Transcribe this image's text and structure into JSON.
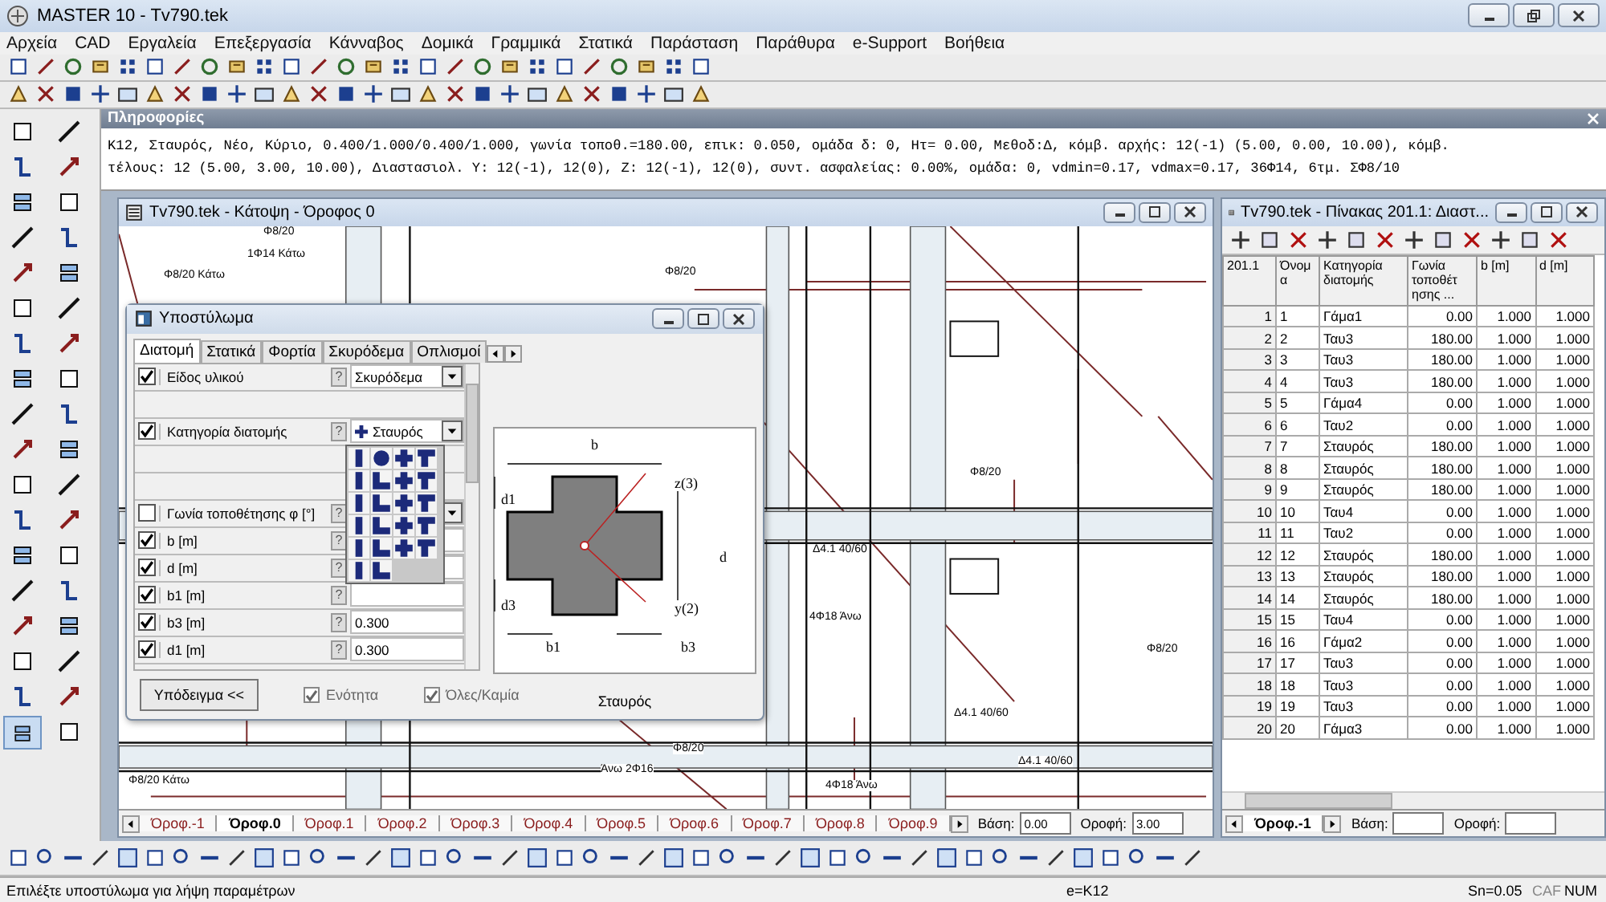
{
  "window": {
    "title": "MASTER 10 - Tv790.tek"
  },
  "menu": [
    "Αρχεία",
    "CAD",
    "Εργαλεία",
    "Επεξεργασία",
    "Κάνναβος",
    "Δομικά",
    "Γραμμικά",
    "Στατικά",
    "Παράσταση",
    "Παράθυρα",
    "e-Support",
    "Βοήθεια"
  ],
  "info_panel": {
    "title": "Πληροφορίες",
    "lines": [
      "K12, Σταυρός, Νέο, Κύριο, 0.400/1.000/0.400/1.000, γωνία τοποθ.=180.00,  επικ: 0.050, ομάδα δ: 0, Ητ= 0.00, Μεθοδ:Δ,  κόμβ. αρχής: 12(-1) (5.00, 0.00, 10.00),  κόμβ.",
      "τέλους: 12 (5.00, 3.00, 10.00), Διαστασιολ. Υ: 12(-1), 12(0), Z: 12(-1), 12(0), συντ. ασφαλείας: 0.00%,  ομάδα: 0, vdmin=0.17, vdmax=0.17,  36Φ14,  6τμ. ΣΦ8/10"
    ]
  },
  "plan_window": {
    "title": "Tv790.tek - Κάτοψη - Όροφος 0",
    "labels": [
      "1Φ14 Κάτω",
      "Φ8/20 Κάτω",
      "Φ8/20",
      "Φ8/20",
      "Δ4.1 40/60",
      "4Φ18 Άνω",
      "Φ8/20",
      "Δ4.1 40/60",
      "Φ8/20",
      "4Φ18 Άνω",
      "Δ4.1 40/60",
      "Φ8/20 Κάτω",
      "Άνω 2Φ16",
      "Φ8/20"
    ],
    "tabs": [
      {
        "label": "Όροφ.-1",
        "selected": false
      },
      {
        "label": "Όροφ.0",
        "selected": true
      },
      {
        "label": "Όροφ.1",
        "selected": false
      },
      {
        "label": "Όροφ.2",
        "selected": false
      },
      {
        "label": "Όροφ.3",
        "selected": false
      },
      {
        "label": "Όροφ.4",
        "selected": false
      },
      {
        "label": "Όροφ.5",
        "selected": false
      },
      {
        "label": "Όροφ.6",
        "selected": false
      },
      {
        "label": "Όροφ.7",
        "selected": false
      },
      {
        "label": "Όροφ.8",
        "selected": false
      },
      {
        "label": "Όροφ.9",
        "selected": false
      }
    ],
    "base_label": "Βάση:",
    "base_value": "0.00",
    "top_label": "Οροφή:",
    "top_value": "3.00"
  },
  "dialog": {
    "title": "Υποστύλωμα",
    "tabs": [
      {
        "label": "Διατομή",
        "selected": true
      },
      {
        "label": "Στατικά",
        "selected": false
      },
      {
        "label": "Φορτία",
        "selected": false
      },
      {
        "label": "Σκυρόδεμα",
        "selected": false
      },
      {
        "label": "Οπλισμοί",
        "selected": false
      }
    ],
    "rows": [
      {
        "kind": "dropdown",
        "label": "Είδος υλικού",
        "checked": true,
        "value": "Σκυρόδεμα"
      },
      {
        "kind": "spacer"
      },
      {
        "kind": "dropdown",
        "label": "Κατηγορία διατομής",
        "checked": true,
        "value": "Σταυρός"
      },
      {
        "kind": "spacer"
      },
      {
        "kind": "spacer"
      },
      {
        "kind": "dropdown",
        "label": "Γωνία τοποθέτησης φ [°]",
        "checked": false
      },
      {
        "kind": "text",
        "label": "b [m]",
        "checked": true
      },
      {
        "kind": "text",
        "label": "d [m]",
        "checked": true
      },
      {
        "kind": "text",
        "label": "b1 [m]",
        "checked": true
      },
      {
        "kind": "text",
        "label": "b3 [m]",
        "checked": true,
        "value": "0.300"
      },
      {
        "kind": "text",
        "label": "d1 [m]",
        "checked": true,
        "value": "0.300"
      }
    ],
    "help": "?",
    "section": {
      "labels": [
        "b",
        "d1",
        "z(3)",
        "d",
        "d3",
        "y(2)",
        "b1",
        "b3"
      ],
      "caption": "Σταυρός"
    },
    "sample_button": "Υπόδειγμα <<",
    "options": [
      {
        "label": "Ενότητα",
        "checked": true,
        "disabled": true
      },
      {
        "label": "Όλες/Καμία",
        "checked": true,
        "disabled": true
      }
    ]
  },
  "table_window": {
    "title": "Tv790.tek - Πίνακας 201.1: Διαστ...",
    "columns": [
      "201.1",
      "Όνομ α",
      "Κατηγορία διατομής",
      "Γωνία τοποθέτ ησης ...",
      "b [m]",
      "d [m]"
    ],
    "rows": [
      [
        "1",
        "1",
        "Γάμα1",
        "0.00",
        "1.000",
        "1.000"
      ],
      [
        "2",
        "2",
        "Ταυ3",
        "180.00",
        "1.000",
        "1.000"
      ],
      [
        "3",
        "3",
        "Ταυ3",
        "180.00",
        "1.000",
        "1.000"
      ],
      [
        "4",
        "4",
        "Ταυ3",
        "180.00",
        "1.000",
        "1.000"
      ],
      [
        "5",
        "5",
        "Γάμα4",
        "0.00",
        "1.000",
        "1.000"
      ],
      [
        "6",
        "6",
        "Ταυ2",
        "0.00",
        "1.000",
        "1.000"
      ],
      [
        "7",
        "7",
        "Σταυρός",
        "180.00",
        "1.000",
        "1.000"
      ],
      [
        "8",
        "8",
        "Σταυρός",
        "180.00",
        "1.000",
        "1.000"
      ],
      [
        "9",
        "9",
        "Σταυρός",
        "180.00",
        "1.000",
        "1.000"
      ],
      [
        "10",
        "10",
        "Ταυ4",
        "0.00",
        "1.000",
        "1.000"
      ],
      [
        "11",
        "11",
        "Ταυ2",
        "0.00",
        "1.000",
        "1.000"
      ],
      [
        "12",
        "12",
        "Σταυρός",
        "180.00",
        "1.000",
        "1.000"
      ],
      [
        "13",
        "13",
        "Σταυρός",
        "180.00",
        "1.000",
        "1.000"
      ],
      [
        "14",
        "14",
        "Σταυρός",
        "180.00",
        "1.000",
        "1.000"
      ],
      [
        "15",
        "15",
        "Ταυ4",
        "0.00",
        "1.000",
        "1.000"
      ],
      [
        "16",
        "16",
        "Γάμα2",
        "0.00",
        "1.000",
        "1.000"
      ],
      [
        "17",
        "17",
        "Ταυ3",
        "0.00",
        "1.000",
        "1.000"
      ],
      [
        "18",
        "18",
        "Ταυ3",
        "0.00",
        "1.000",
        "1.000"
      ],
      [
        "19",
        "19",
        "Ταυ3",
        "0.00",
        "1.000",
        "1.000"
      ],
      [
        "20",
        "20",
        "Γάμα3",
        "0.00",
        "1.000",
        "1.000"
      ]
    ],
    "tabs": [
      {
        "label": "Όροφ.-1",
        "selected": true
      }
    ],
    "base_label": "Βάση:",
    "top_label": "Οροφή:"
  },
  "status_bar": {
    "message": "Επιλέξτε υποστύλωμα για λήψη παραμέτρων",
    "element": "e=K12",
    "snap": "Sn=0.05",
    "caf": "CAF",
    "num": "NUM"
  }
}
